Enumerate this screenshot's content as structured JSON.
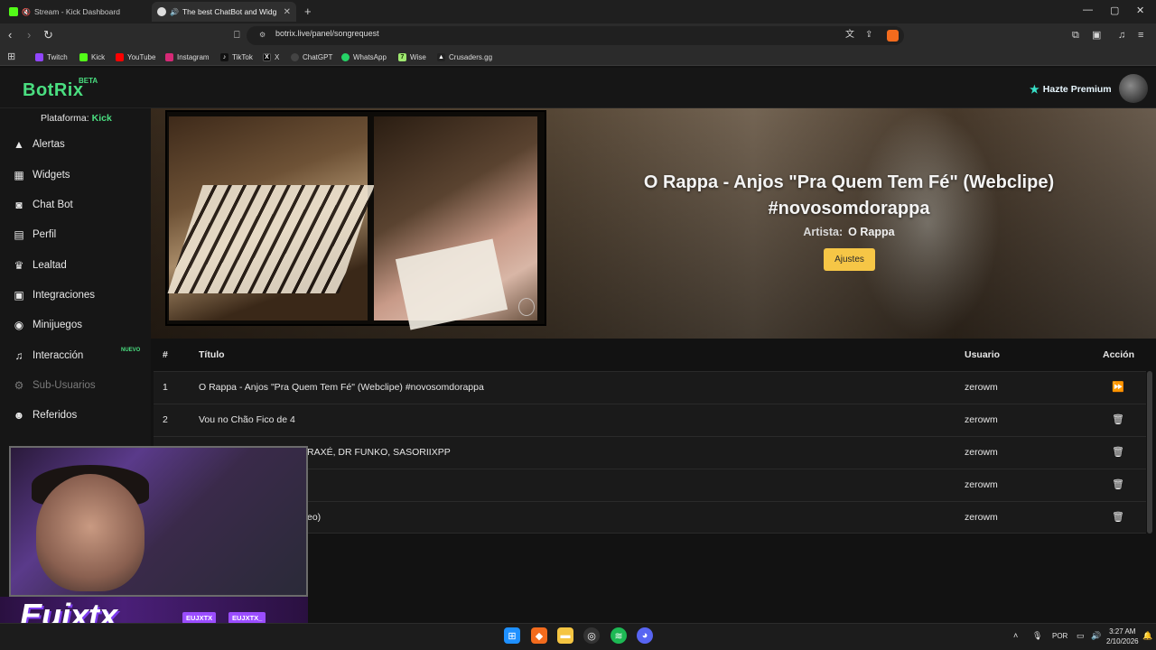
{
  "browser": {
    "tabs": [
      {
        "title": "Stream - Kick Dashboard",
        "active": false
      },
      {
        "title": "The best ChatBot and Widget",
        "active": true
      }
    ],
    "new_tab": "+",
    "url": "botrix.live/panel/songrequest",
    "bookmarks": [
      "Twitch",
      "Kick",
      "YouTube",
      "Instagram",
      "TikTok",
      "X",
      "ChatGPT",
      "WhatsApp",
      "Wise",
      "Crusaders.gg"
    ]
  },
  "app": {
    "logo": "BotRix",
    "badge": "BETA",
    "premium": "Hazte Premium",
    "platform_label": "Plataforma:",
    "platform_value": "Kick"
  },
  "sidebar": {
    "items": [
      {
        "label": "Alertas",
        "icon": "warning-icon"
      },
      {
        "label": "Widgets",
        "icon": "grid-icon"
      },
      {
        "label": "Chat Bot",
        "icon": "robot-icon"
      },
      {
        "label": "Perfil",
        "icon": "id-card-icon"
      },
      {
        "label": "Lealtad",
        "icon": "trophy-icon"
      },
      {
        "label": "Integraciones",
        "icon": "integrations-icon"
      },
      {
        "label": "Minijuegos",
        "icon": "gamepad-icon"
      },
      {
        "label": "Interacción",
        "icon": "music-icon"
      },
      {
        "label": "Sub-Usuarios",
        "icon": "user-cog-icon"
      },
      {
        "label": "Referidos",
        "icon": "users-icon"
      }
    ],
    "new_badge": "NUEVO"
  },
  "now_playing": {
    "title": "O Rappa - Anjos \"Pra Quem Tem Fé\" (Webclipe) #novosomdorappa",
    "artist_label": "Artista:",
    "artist": "O Rappa",
    "settings_button": "Ajustes"
  },
  "queue": {
    "headers": {
      "num": "#",
      "title": "Título",
      "user": "Usuario",
      "action": "Acción"
    },
    "rows": [
      {
        "num": "1",
        "title": "O Rappa - Anjos \"Pra Quem Tem Fé\" (Webclipe) #novosomdorappa",
        "user": "zerowm",
        "action": "skip"
      },
      {
        "num": "2",
        "title": "Vou no Chão Fico de 4",
        "user": "zerowm",
        "action": "delete"
      },
      {
        "num": "",
        "title": "RAXÉ, DR FUNKO, SASORIIXPP",
        "user": "zerowm",
        "action": "delete"
      },
      {
        "num": "",
        "title": "",
        "user": "zerowm",
        "action": "delete"
      },
      {
        "num": "",
        "title": "eo)",
        "user": "zerowm",
        "action": "delete"
      }
    ]
  },
  "overlay": {
    "name": "Eujxtx",
    "handle_1": "EUJXTX",
    "handle_2": "EUJXTX_"
  },
  "taskbar": {
    "lang": "POR",
    "time": "3:27 AM",
    "date": "2/10/2026"
  }
}
